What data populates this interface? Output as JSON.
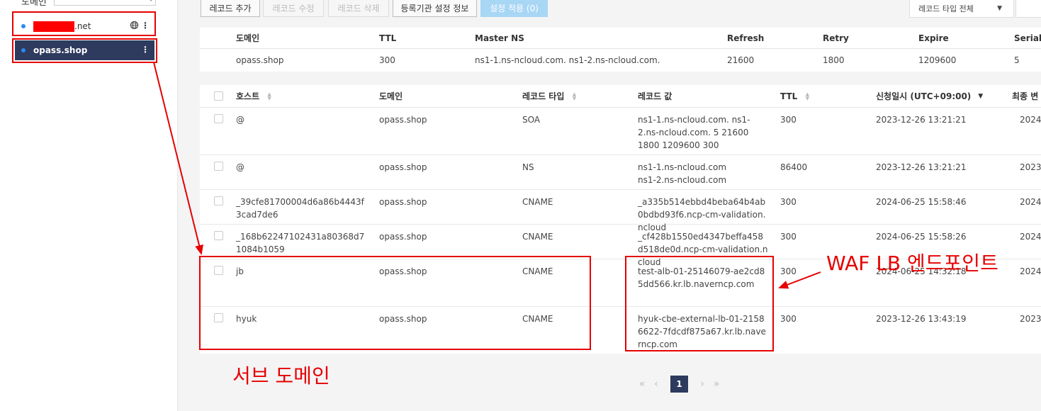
{
  "sidebar": {
    "label": "도메인",
    "zones": [
      {
        "name": ".net",
        "redacted": true
      },
      {
        "name": "opass.shop",
        "active": true
      }
    ]
  },
  "toolbar": {
    "add": "레코드 추가",
    "edit": "레코드 수정",
    "delete": "레코드 삭제",
    "registrar": "등록기관 설정 정보",
    "apply": "설정 적용 (0)",
    "type_filter": "레코드 타입 전체"
  },
  "soa": {
    "headers": [
      "도메인",
      "TTL",
      "Master NS",
      "Refresh",
      "Retry",
      "Expire",
      "Serial"
    ],
    "row": [
      "opass.shop",
      "300",
      "ns1-1.ns-ncloud.com. ns1-2.ns-ncloud.com.",
      "21600",
      "1800",
      "1209600",
      "5"
    ]
  },
  "records": {
    "headers": {
      "host": "호스트",
      "domain": "도메인",
      "type": "레코드 타입",
      "value": "레코드 값",
      "ttl": "TTL",
      "date": "신청일시 (UTC+09:00)",
      "last": "최종 변"
    },
    "rows": [
      {
        "host": "@",
        "domain": "opass.shop",
        "type": "SOA",
        "value": "ns1-1.ns-ncloud.com. ns1-2.ns-ncloud.com. 5 21600 1800 1209600 300",
        "ttl": "300",
        "date": "2023-12-26 13:21:21",
        "last": "2024-"
      },
      {
        "host": "@",
        "domain": "opass.shop",
        "type": "NS",
        "value": "ns1-1.ns-ncloud.com ns1-2.ns-ncloud.com",
        "ttl": "86400",
        "date": "2023-12-26 13:21:21",
        "last": "2023-"
      },
      {
        "host": "_39cfe81700004d6a86b4443f3cad7de6",
        "domain": "opass.shop",
        "type": "CNAME",
        "value": "_a335b514ebbd4beba64b4ab0bdbd93f6.ncp-cm-validation.ncloud",
        "ttl": "300",
        "date": "2024-06-25 15:58:46",
        "last": "2024-"
      },
      {
        "host": "_168b62247102431a80368d71084b1059",
        "domain": "opass.shop",
        "type": "CNAME",
        "value": "_cf428b1550ed4347beffa458d518de0d.ncp-cm-validation.ncloud",
        "ttl": "300",
        "date": "2024-06-25 15:58:26",
        "last": "2024-"
      },
      {
        "host": "jb",
        "domain": "opass.shop",
        "type": "CNAME",
        "value": "test-alb-01-25146079-ae2cd85dd566.kr.lb.naverncp.com",
        "ttl": "300",
        "date": "2024-06-25 14:32:18",
        "last": "2024-"
      },
      {
        "host": "hyuk",
        "domain": "opass.shop",
        "type": "CNAME",
        "value": "hyuk-cbe-external-lb-01-21586622-7fdcdf875a67.kr.lb.naverncp.com",
        "ttl": "300",
        "date": "2023-12-26 13:43:19",
        "last": "2023-"
      }
    ]
  },
  "pagination": {
    "current": "1"
  },
  "annotations": {
    "subdomain": "서브 도메인",
    "waf": "WAF LB 엔드포인트",
    "color": "#e60000"
  }
}
